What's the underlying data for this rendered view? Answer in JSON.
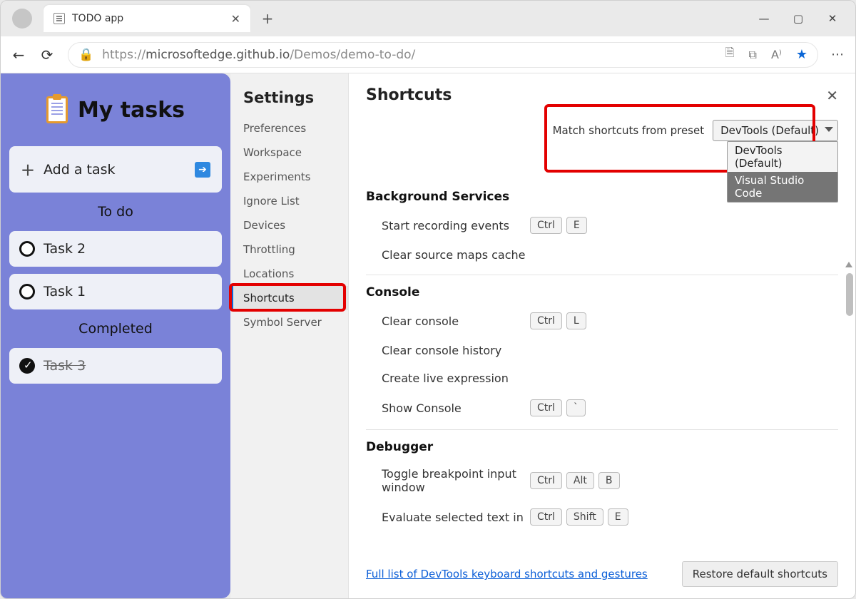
{
  "browser": {
    "tab_title": "TODO app",
    "url_scheme": "https://",
    "url_host": "microsoftedge.github.io",
    "url_path": "/Demos/demo-to-do/"
  },
  "todo": {
    "title": "My tasks",
    "add_label": "Add a task",
    "todo_heading": "To do",
    "completed_heading": "Completed",
    "tasks_todo": [
      "Task 2",
      "Task 1"
    ],
    "tasks_done": [
      "Task 3"
    ]
  },
  "settings": {
    "title": "Settings",
    "items": [
      "Preferences",
      "Workspace",
      "Experiments",
      "Ignore List",
      "Devices",
      "Throttling",
      "Locations",
      "Shortcuts",
      "Symbol Server"
    ],
    "active_index": 7
  },
  "shortcuts": {
    "title": "Shortcuts",
    "preset_label": "Match shortcuts from preset",
    "preset_selected": "DevTools (Default)",
    "preset_options": [
      "DevTools (Default)",
      "Visual Studio Code"
    ],
    "groups": [
      {
        "name": "Background Services",
        "rows": [
          {
            "label": "Start recording events",
            "keys": [
              "Ctrl",
              "E"
            ]
          },
          {
            "label": "Clear source maps cache",
            "keys": []
          }
        ]
      },
      {
        "name": "Console",
        "rows": [
          {
            "label": "Clear console",
            "keys": [
              "Ctrl",
              "L"
            ]
          },
          {
            "label": "Clear console history",
            "keys": []
          },
          {
            "label": "Create live expression",
            "keys": []
          },
          {
            "label": "Show Console",
            "keys": [
              "Ctrl",
              "`"
            ]
          }
        ]
      },
      {
        "name": "Debugger",
        "rows": [
          {
            "label": "Toggle breakpoint input window",
            "keys": [
              "Ctrl",
              "Alt",
              "B"
            ]
          },
          {
            "label": "Evaluate selected text in",
            "keys": [
              "Ctrl",
              "Shift",
              "E"
            ]
          }
        ]
      }
    ],
    "footer_link": "Full list of DevTools keyboard shortcuts and gestures",
    "restore_label": "Restore default shortcuts"
  }
}
